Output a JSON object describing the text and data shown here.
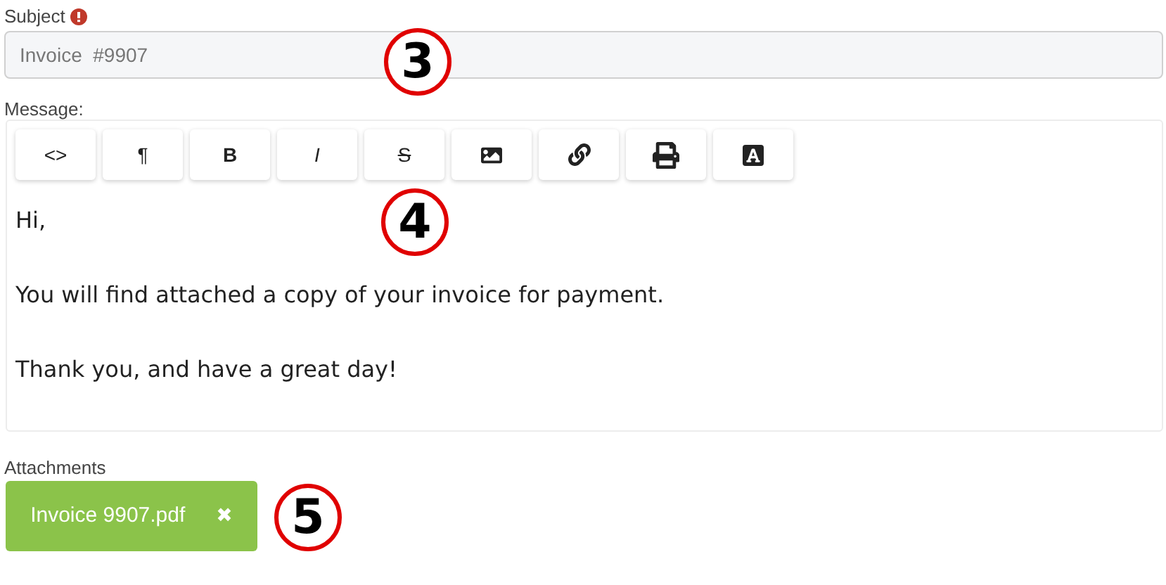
{
  "subject": {
    "label": "Subject",
    "required": true,
    "value": "Invoice  #9907",
    "callout": "3"
  },
  "message": {
    "label": "Message:",
    "callout": "4",
    "toolbar": [
      {
        "kind": "text",
        "label": "<>"
      },
      {
        "kind": "text",
        "label": "¶"
      },
      {
        "kind": "bold",
        "label": "B"
      },
      {
        "kind": "italic",
        "label": "I"
      },
      {
        "kind": "strike",
        "label": "S"
      },
      {
        "kind": "image"
      },
      {
        "kind": "link"
      },
      {
        "kind": "print"
      },
      {
        "kind": "font"
      }
    ],
    "paragraphs": [
      "Hi,",
      "You will find attached a copy of your invoice for payment.",
      "Thank you, and have a great day!"
    ]
  },
  "attachments": {
    "label": "Attachments",
    "callout": "5",
    "files": [
      {
        "name": "Invoice 9907.pdf",
        "remove": "✖"
      }
    ]
  }
}
